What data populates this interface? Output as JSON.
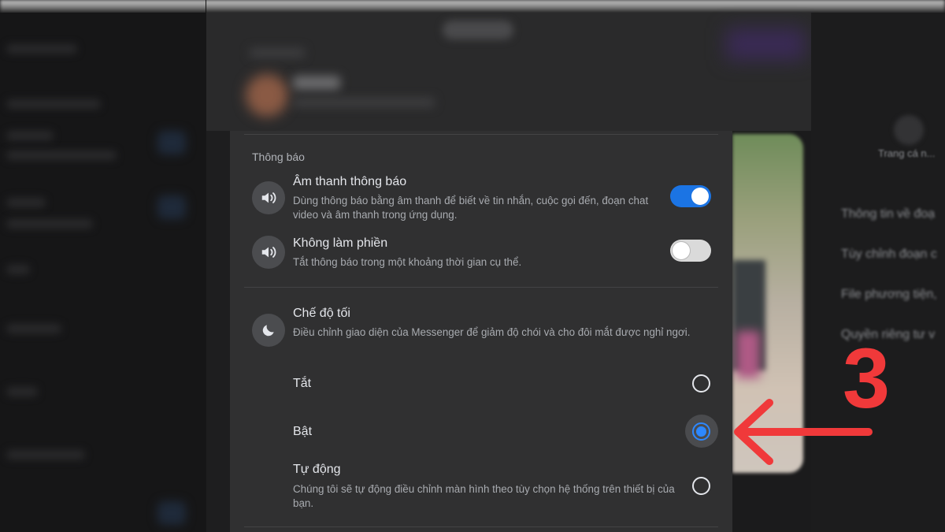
{
  "background": {
    "right_sidebar": {
      "profile_label": "Trang cá n...",
      "items": [
        "Thông tin về đoạ",
        "Tùy chỉnh đoạn c",
        "File phương tiện,",
        "Quyền riêng tư v"
      ]
    }
  },
  "settings": {
    "notifications": {
      "section_label": "Thông báo",
      "sound": {
        "title": "Âm thanh thông báo",
        "description": "Dùng thông báo bằng âm thanh để biết về tin nhắn, cuộc gọi đến, đoạn chat video và âm thanh trong ứng dụng.",
        "enabled": true,
        "icon": "speaker-icon"
      },
      "dnd": {
        "title": "Không làm phiền",
        "description": "Tắt thông báo trong một khoảng thời gian cụ thể.",
        "enabled": false,
        "icon": "speaker-icon"
      }
    },
    "dark_mode": {
      "title": "Chế độ tối",
      "description": "Điều chỉnh giao diện của Messenger để giảm độ chói và cho đôi mắt được nghỉ ngơi.",
      "icon": "moon-icon",
      "options": [
        {
          "label": "Tắt",
          "checked": false
        },
        {
          "label": "Bật",
          "checked": true
        },
        {
          "label": "Tự động",
          "checked": false,
          "description": "Chúng tôi sẽ tự động điều chỉnh màn hình theo tùy chọn hệ thống trên thiết bị của bạn."
        }
      ]
    }
  },
  "annotation": {
    "step": "3",
    "color": "#f0393a"
  },
  "colors": {
    "accent": "#1b74e4",
    "radio_selected": "#2d88ff",
    "panel_bg": "#303031"
  }
}
